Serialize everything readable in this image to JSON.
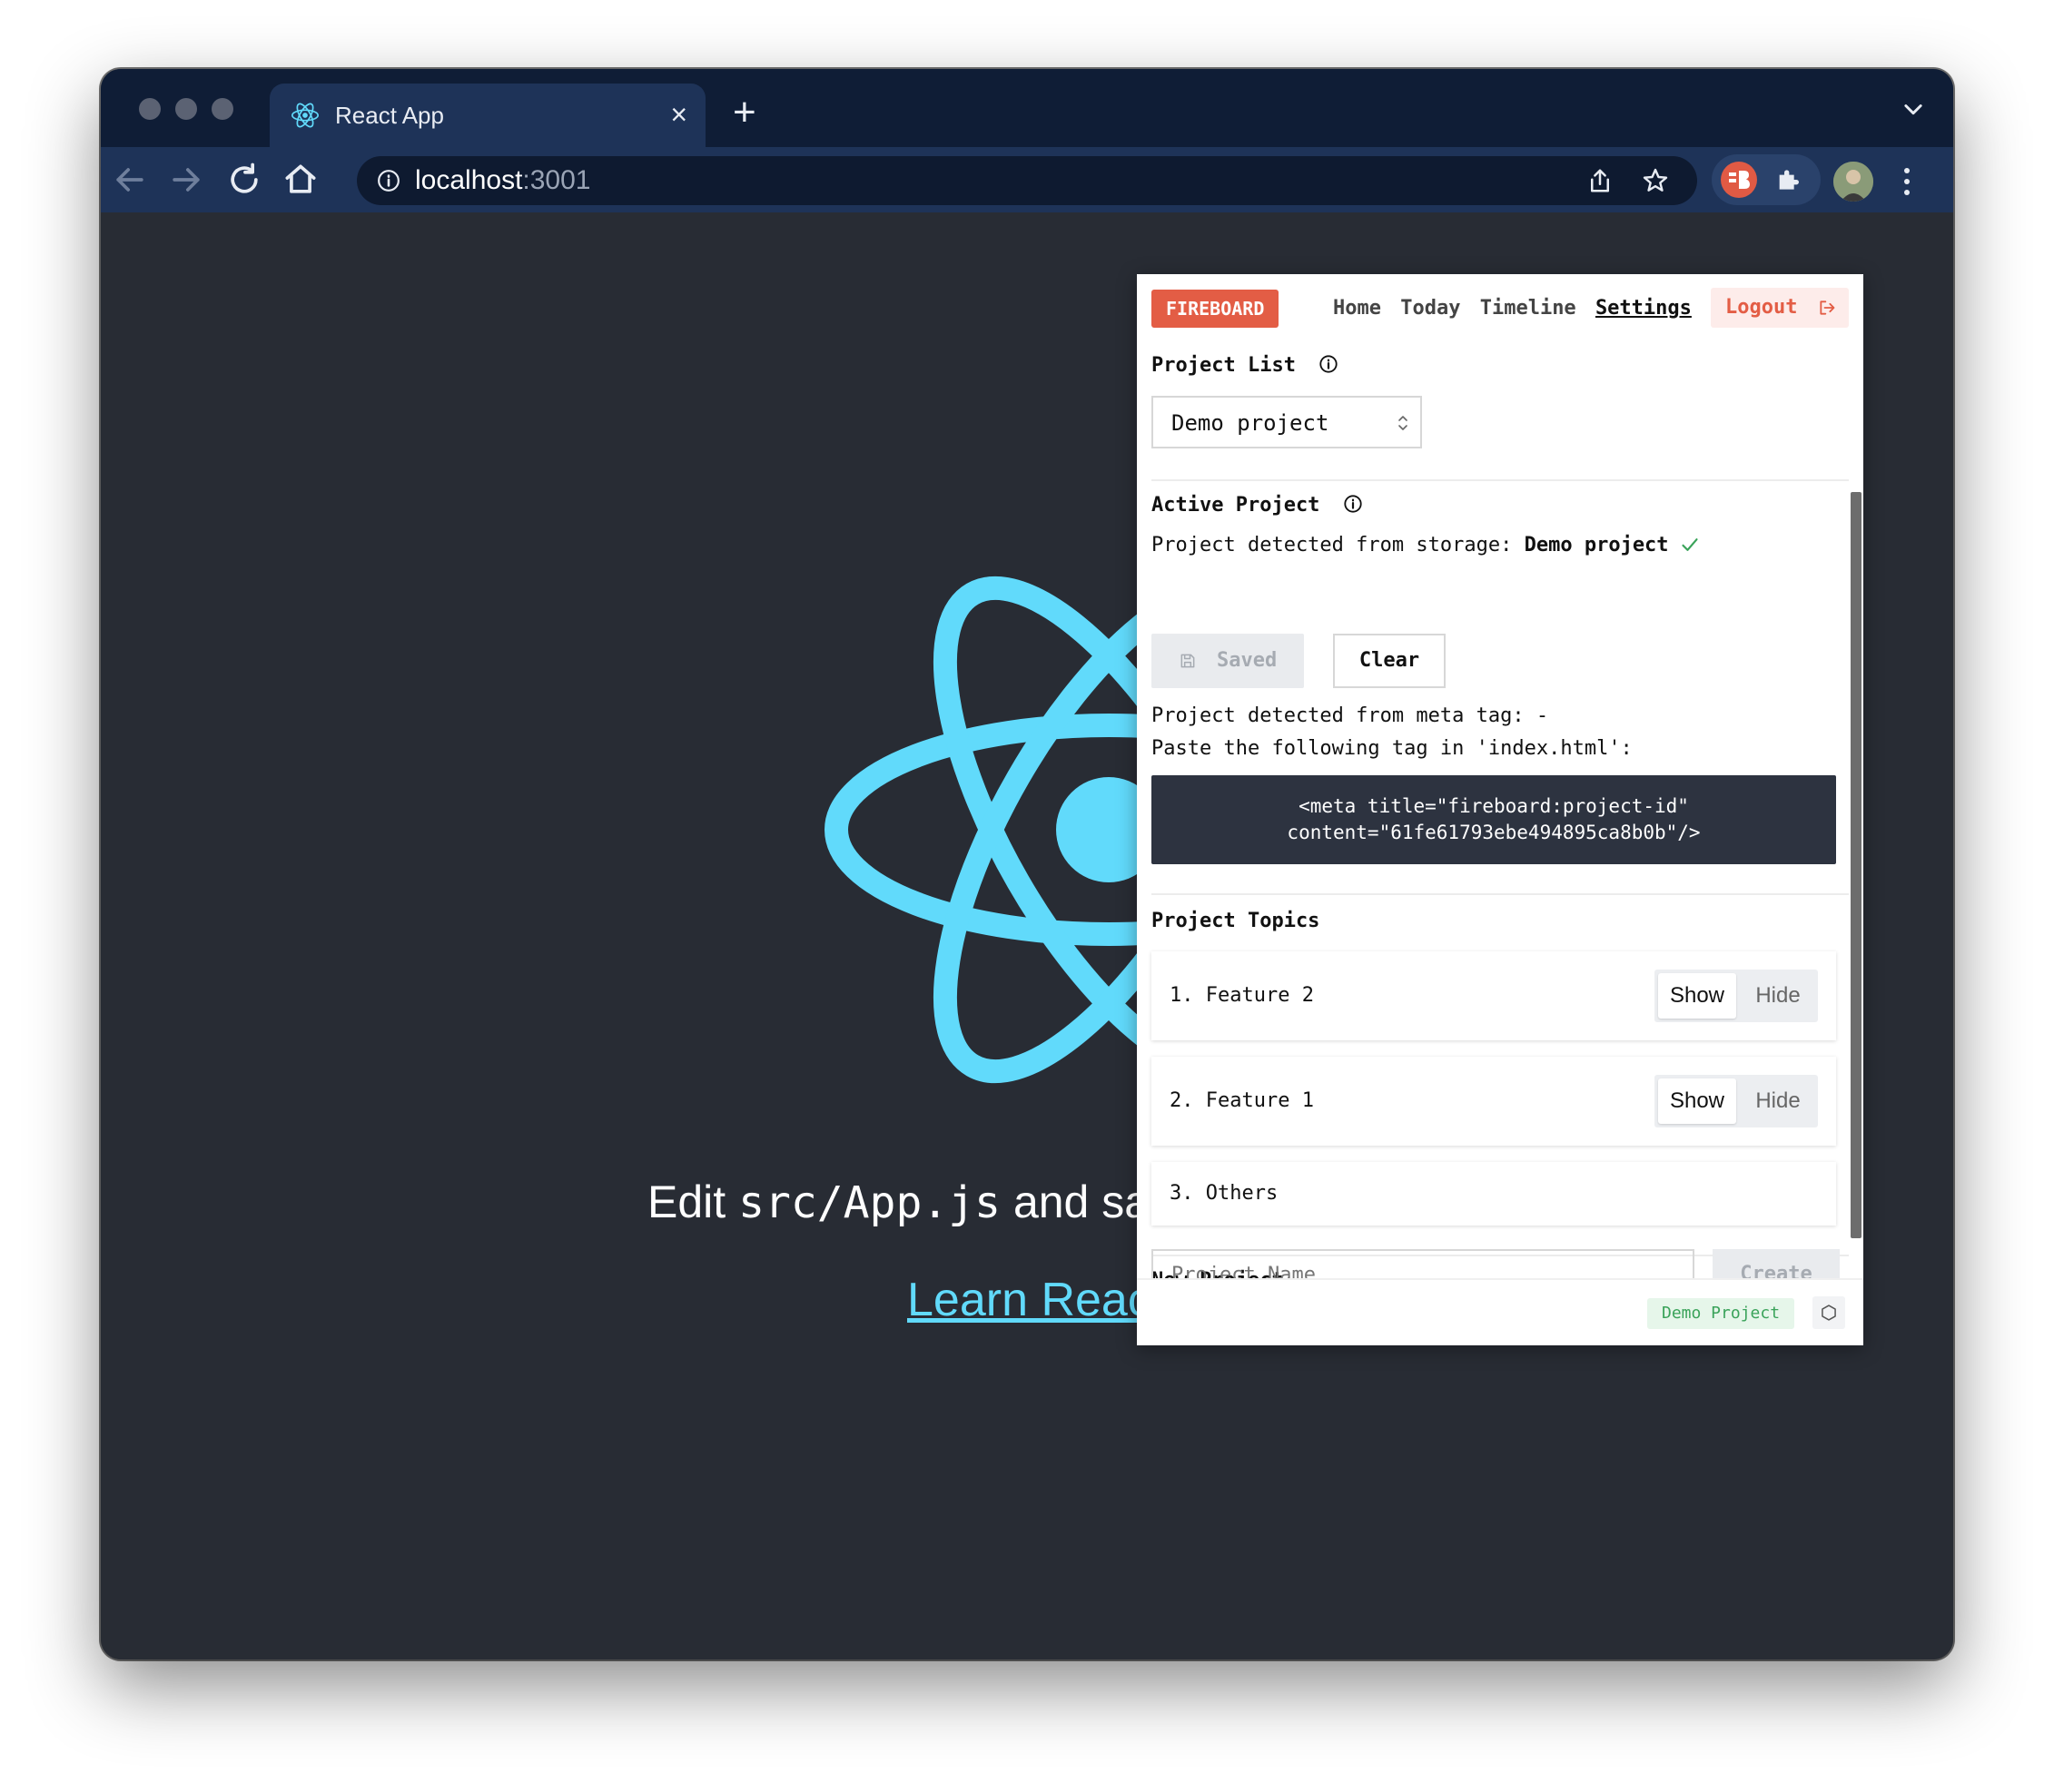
{
  "browser": {
    "tab_title": "React App",
    "tab_close_icon": "×",
    "new_tab_icon": "+",
    "url_host": "localhost",
    "url_port": ":3001"
  },
  "page": {
    "edit_prefix": "Edit ",
    "edit_code": "src/App.js",
    "edit_suffix": " and save to reload.",
    "learn_link": "Learn React",
    "accent_color": "#61dafb",
    "background_color": "#282c34"
  },
  "popup": {
    "brand": "FIREBOARD",
    "brand_color": "#e35d45",
    "nav": {
      "home": "Home",
      "today": "Today",
      "timeline": "Timeline",
      "settings": "Settings",
      "logout": "Logout"
    },
    "project_list": {
      "title": "Project List",
      "selected": "Demo project"
    },
    "active_project": {
      "title": "Active Project",
      "storage_label": "Project detected from storage: ",
      "storage_value": "Demo project",
      "saved_button": "Saved",
      "clear_button": "Clear",
      "meta_label": "Project detected from meta tag: -",
      "paste_label": "Paste the following tag in 'index.html':",
      "code_line1": "<meta title=\"fireboard:project-id\"",
      "code_line2": "content=\"61fe61793ebe494895ca8b0b\"/>"
    },
    "project_topics": {
      "title": "Project Topics",
      "items": [
        {
          "label": "1. Feature 2",
          "show": "Show",
          "hide": "Hide"
        },
        {
          "label": "2. Feature 1",
          "show": "Show",
          "hide": "Hide"
        },
        {
          "label": "3. Others"
        }
      ]
    },
    "new_project": {
      "title": "New Project",
      "placeholder": "Project Name",
      "create_button": "Create"
    },
    "footer": {
      "badge": "Demo Project"
    }
  }
}
